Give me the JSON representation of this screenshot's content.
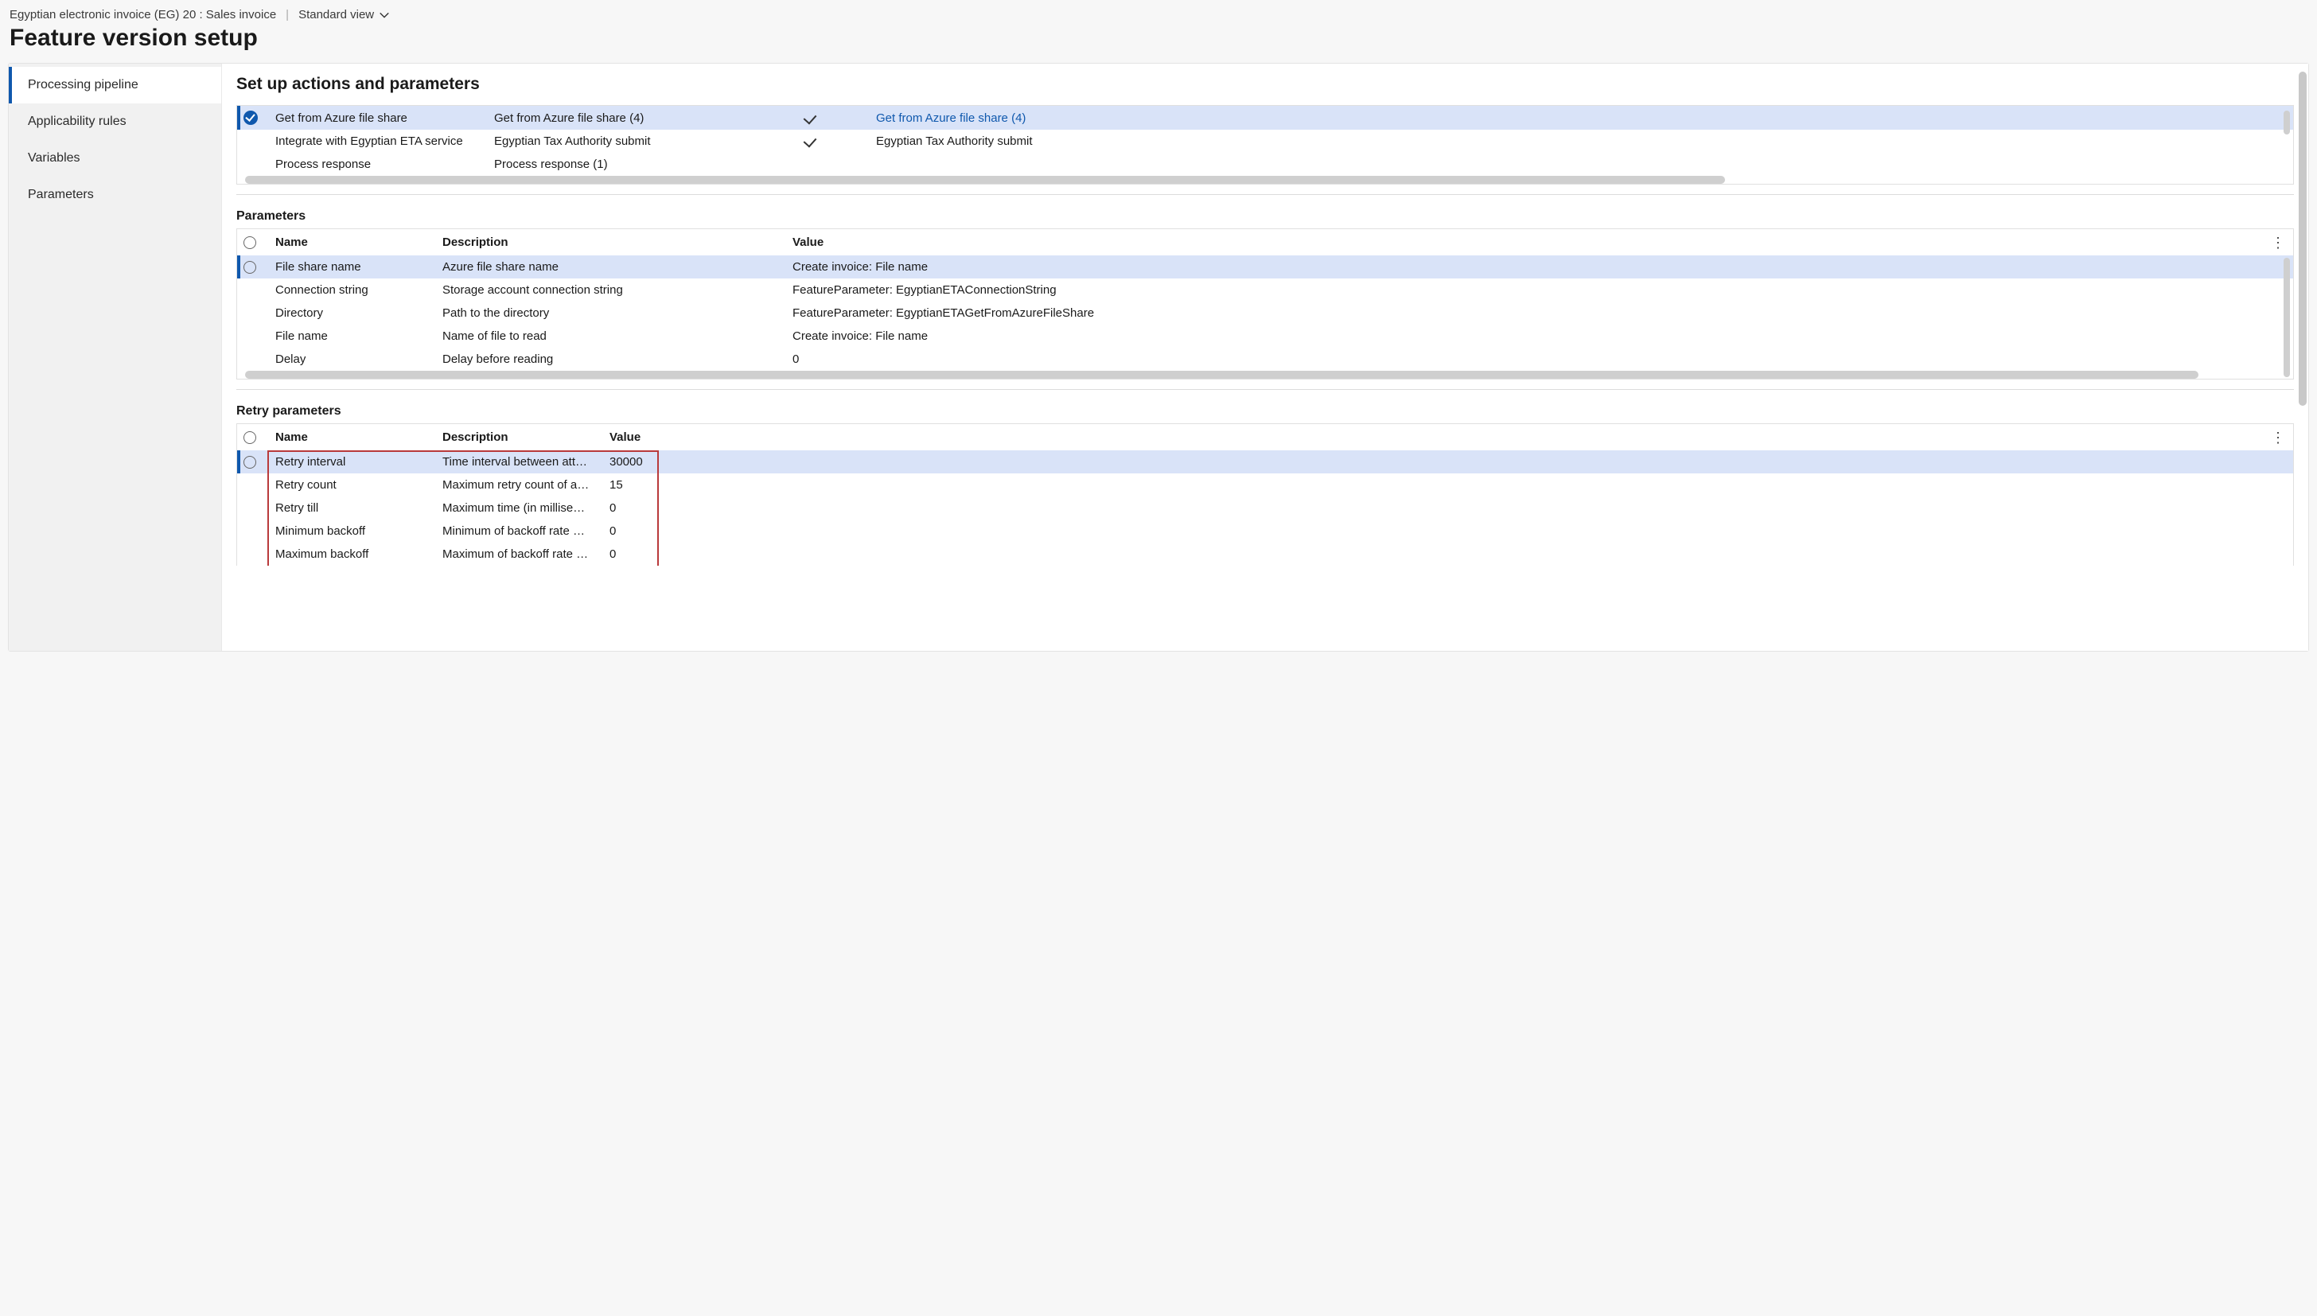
{
  "header": {
    "breadcrumb": "Egyptian electronic invoice (EG) 20 : Sales invoice",
    "view_label": "Standard view",
    "title": "Feature version setup"
  },
  "sidebar": {
    "items": [
      {
        "label": "Processing pipeline",
        "active": true
      },
      {
        "label": "Applicability rules",
        "active": false
      },
      {
        "label": "Variables",
        "active": false
      },
      {
        "label": "Parameters",
        "active": false
      }
    ]
  },
  "main": {
    "heading": "Set up actions and parameters",
    "actions": {
      "rows": [
        {
          "selected": true,
          "c1": "Get from Azure file share",
          "c2": "Get from Azure file share (4)",
          "tick": true,
          "c4": "Get from Azure file share (4)",
          "c4_link": true
        },
        {
          "selected": false,
          "c1": "Integrate with Egyptian ETA service",
          "c2": "Egyptian Tax Authority submit",
          "tick": true,
          "c4": "Egyptian Tax Authority submit",
          "c4_link": false
        },
        {
          "selected": false,
          "c1": "Process response",
          "c2": "Process response (1)",
          "tick": false,
          "c4": "",
          "c4_link": false
        }
      ]
    },
    "parameters": {
      "heading": "Parameters",
      "columns": {
        "name": "Name",
        "desc": "Description",
        "value": "Value"
      },
      "rows": [
        {
          "selected": true,
          "name": "File share name",
          "desc": "Azure file share name",
          "value": "Create invoice: File name"
        },
        {
          "selected": false,
          "name": "Connection string",
          "desc": "Storage account connection string",
          "value": "FeatureParameter: EgyptianETAConnectionString"
        },
        {
          "selected": false,
          "name": "Directory",
          "desc": "Path to the directory",
          "value": "FeatureParameter: EgyptianETAGetFromAzureFileShare"
        },
        {
          "selected": false,
          "name": "File name",
          "desc": "Name of file to read",
          "value": "Create invoice: File name"
        },
        {
          "selected": false,
          "name": "Delay",
          "desc": "Delay before reading",
          "value": "0"
        }
      ]
    },
    "retry": {
      "heading": "Retry parameters",
      "columns": {
        "name": "Name",
        "desc": "Description",
        "value": "Value"
      },
      "rows": [
        {
          "selected": true,
          "name": "Retry interval",
          "desc": "Time interval between att…",
          "value": "30000"
        },
        {
          "selected": false,
          "name": "Retry count",
          "desc": "Maximum retry count of a…",
          "value": "15"
        },
        {
          "selected": false,
          "name": "Retry till",
          "desc": "Maximum time (in millise…",
          "value": "0"
        },
        {
          "selected": false,
          "name": "Minimum backoff",
          "desc": "Minimum of backoff rate …",
          "value": "0"
        },
        {
          "selected": false,
          "name": "Maximum backoff",
          "desc": "Maximum of backoff rate …",
          "value": "0"
        }
      ]
    }
  }
}
